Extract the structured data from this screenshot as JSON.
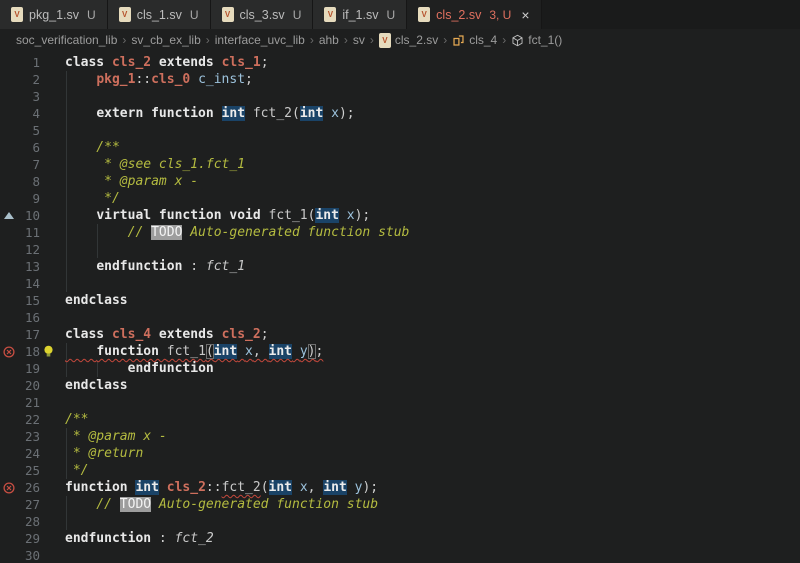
{
  "tabs": [
    {
      "label": "pkg_1.sv",
      "badge": "U",
      "active": false
    },
    {
      "label": "cls_1.sv",
      "badge": "U",
      "active": false
    },
    {
      "label": "cls_3.sv",
      "badge": "U",
      "active": false
    },
    {
      "label": "if_1.sv",
      "badge": "U",
      "active": false
    },
    {
      "label": "cls_2.sv",
      "badge": "3, U",
      "active": true,
      "close": "×"
    }
  ],
  "breadcrumb": {
    "separator": "›",
    "items": [
      {
        "label": "soc_verification_lib"
      },
      {
        "label": "sv_cb_ex_lib"
      },
      {
        "label": "interface_uvc_lib"
      },
      {
        "label": "ahb"
      },
      {
        "label": "sv"
      },
      {
        "label": "cls_2.sv",
        "icon": "file"
      },
      {
        "label": "cls_4",
        "icon": "class"
      },
      {
        "label": "fct_1()",
        "icon": "method"
      }
    ]
  },
  "colors": {
    "editor_bg": "#1e1f1f",
    "tab_active_text": "#e0705f",
    "keyword": "#e8e8e8",
    "class_name": "#ce6f5d",
    "identifier": "#9cc2dc",
    "comment": "#b4bb40",
    "error": "#c5483c",
    "word_highlight_bg": "#1a4367",
    "lightbulb": "#dcd32f"
  },
  "editor": {
    "guides": [
      {
        "col": 0,
        "from": 2,
        "to": 14
      },
      {
        "col": 4,
        "from": 11,
        "to": 12
      },
      {
        "col": 0,
        "from": 18,
        "to": 19
      },
      {
        "col": 4,
        "from": 19,
        "to": 19
      },
      {
        "col": 0,
        "from": 23,
        "to": 25
      },
      {
        "col": 0,
        "from": 27,
        "to": 28
      }
    ],
    "lines": [
      {
        "num": 1,
        "tokens": [
          {
            "c": "kw",
            "v": "class "
          },
          {
            "c": "cls",
            "v": "cls_2"
          },
          {
            "c": "kw",
            "v": " extends "
          },
          {
            "c": "cls",
            "v": "cls_1"
          },
          {
            "c": "tx",
            "v": ";"
          }
        ]
      },
      {
        "num": 2,
        "tokens": [
          {
            "c": "tx",
            "v": "    "
          },
          {
            "c": "cls",
            "v": "pkg_1"
          },
          {
            "c": "tx",
            "v": "::"
          },
          {
            "c": "cls",
            "v": "cls_0"
          },
          {
            "c": "tx",
            "v": " "
          },
          {
            "c": "id",
            "v": "c_inst"
          },
          {
            "c": "tx",
            "v": ";"
          }
        ]
      },
      {
        "num": 3,
        "tokens": []
      },
      {
        "num": 4,
        "tokens": [
          {
            "c": "tx",
            "v": "    "
          },
          {
            "c": "kw",
            "v": "extern function "
          },
          {
            "c": "hl",
            "v": "int"
          },
          {
            "c": "tx",
            "v": " "
          },
          {
            "c": "fn",
            "v": "fct_2"
          },
          {
            "c": "tx",
            "v": "("
          },
          {
            "c": "hl",
            "v": "int"
          },
          {
            "c": "tx",
            "v": " "
          },
          {
            "c": "id",
            "v": "x"
          },
          {
            "c": "tx",
            "v": ");"
          }
        ]
      },
      {
        "num": 5,
        "tokens": []
      },
      {
        "num": 6,
        "tokens": [
          {
            "c": "cm",
            "v": "    /**"
          }
        ]
      },
      {
        "num": 7,
        "tokens": [
          {
            "c": "cm",
            "v": "     * @see cls_1.fct_1"
          }
        ]
      },
      {
        "num": 8,
        "tokens": [
          {
            "c": "cm",
            "v": "     * @param x -"
          }
        ]
      },
      {
        "num": 9,
        "tokens": [
          {
            "c": "cm",
            "v": "     */"
          }
        ]
      },
      {
        "num": 10,
        "gutter": "override",
        "tokens": [
          {
            "c": "tx",
            "v": "    "
          },
          {
            "c": "kw",
            "v": "virtual function void "
          },
          {
            "c": "fn",
            "v": "fct_1"
          },
          {
            "c": "tx",
            "v": "("
          },
          {
            "c": "hl",
            "v": "int"
          },
          {
            "c": "tx",
            "v": " "
          },
          {
            "c": "id",
            "v": "x"
          },
          {
            "c": "tx",
            "v": ");"
          }
        ]
      },
      {
        "num": 11,
        "tokens": [
          {
            "c": "cm",
            "v": "        // "
          },
          {
            "c": "todo",
            "v": "TODO"
          },
          {
            "c": "cm",
            "v": " Auto-generated function stub"
          }
        ]
      },
      {
        "num": 12,
        "tokens": []
      },
      {
        "num": 13,
        "tokens": [
          {
            "c": "tx",
            "v": "    "
          },
          {
            "c": "kw",
            "v": "endfunction"
          },
          {
            "c": "tx",
            "v": " : "
          },
          {
            "c": "fni",
            "v": "fct_1"
          }
        ]
      },
      {
        "num": 14,
        "tokens": []
      },
      {
        "num": 15,
        "tokens": [
          {
            "c": "kw",
            "v": "endclass"
          }
        ]
      },
      {
        "num": 16,
        "tokens": []
      },
      {
        "num": 17,
        "tokens": [
          {
            "c": "kw",
            "v": "class "
          },
          {
            "c": "cls",
            "v": "cls_4"
          },
          {
            "c": "kw",
            "v": " extends "
          },
          {
            "c": "cls",
            "v": "cls_2"
          },
          {
            "c": "tx",
            "v": ";"
          }
        ]
      },
      {
        "num": 18,
        "gutter": "error",
        "lightbulb": true,
        "underlineAll": true,
        "tokens": [
          {
            "c": "tx",
            "v": "    "
          },
          {
            "c": "kw",
            "v": "function "
          },
          {
            "c": "fn",
            "v": "fct_1"
          },
          {
            "c": "tx",
            "v": "(",
            "box": true
          },
          {
            "c": "hl",
            "v": "int"
          },
          {
            "c": "tx",
            "v": " "
          },
          {
            "c": "id",
            "v": "x"
          },
          {
            "c": "tx",
            "v": ", "
          },
          {
            "c": "hl",
            "v": "int"
          },
          {
            "c": "tx",
            "v": " "
          },
          {
            "c": "id",
            "v": "y"
          },
          {
            "c": "tx",
            "v": ")",
            "box": true
          },
          {
            "c": "tx",
            "v": ";"
          }
        ]
      },
      {
        "num": 19,
        "tokens": [
          {
            "c": "tx",
            "v": "        "
          },
          {
            "c": "kw",
            "v": "endfunction"
          }
        ]
      },
      {
        "num": 20,
        "tokens": [
          {
            "c": "kw",
            "v": "endclass"
          }
        ]
      },
      {
        "num": 21,
        "tokens": []
      },
      {
        "num": 22,
        "tokens": [
          {
            "c": "cm",
            "v": "/**"
          }
        ]
      },
      {
        "num": 23,
        "tokens": [
          {
            "c": "cm",
            "v": " * @param x -"
          }
        ]
      },
      {
        "num": 24,
        "tokens": [
          {
            "c": "cm",
            "v": " * @return"
          }
        ]
      },
      {
        "num": 25,
        "tokens": [
          {
            "c": "cm",
            "v": " */"
          }
        ]
      },
      {
        "num": 26,
        "gutter": "error",
        "tokens": [
          {
            "c": "kw",
            "v": "function "
          },
          {
            "c": "hl",
            "v": "int"
          },
          {
            "c": "tx",
            "v": " "
          },
          {
            "c": "cls",
            "v": "cls_2"
          },
          {
            "c": "tx",
            "v": "::"
          },
          {
            "c": "fn",
            "v": "fct_2",
            "u": true
          },
          {
            "c": "tx",
            "v": "("
          },
          {
            "c": "hl",
            "v": "int"
          },
          {
            "c": "tx",
            "v": " "
          },
          {
            "c": "id",
            "v": "x"
          },
          {
            "c": "tx",
            "v": ", "
          },
          {
            "c": "hl",
            "v": "int"
          },
          {
            "c": "tx",
            "v": " "
          },
          {
            "c": "id",
            "v": "y"
          },
          {
            "c": "tx",
            "v": ");"
          }
        ]
      },
      {
        "num": 27,
        "tokens": [
          {
            "c": "cm",
            "v": "    // "
          },
          {
            "c": "todo",
            "v": "TODO"
          },
          {
            "c": "cm",
            "v": " Auto-generated function stub"
          }
        ]
      },
      {
        "num": 28,
        "tokens": []
      },
      {
        "num": 29,
        "tokens": [
          {
            "c": "kw",
            "v": "endfunction"
          },
          {
            "c": "tx",
            "v": " : "
          },
          {
            "c": "fni",
            "v": "fct_2"
          }
        ]
      },
      {
        "num": 30,
        "tokens": []
      }
    ]
  }
}
